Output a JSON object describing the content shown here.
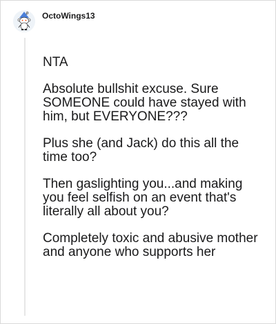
{
  "comment": {
    "username": "OctoWings13",
    "avatar_icon": "snoo-avatar-icon",
    "paragraphs": [
      "NTA",
      "Absolute bullshit excuse. Sure SOMEONE could have stayed with him, but EVERYONE???",
      "Plus she (and Jack) do this all the time too?",
      "Then gaslighting you...and making you feel selfish on an event that's literally all about you?",
      "Completely toxic and abusive mother and anyone who supports her"
    ]
  },
  "colors": {
    "text": "#1a1a1b",
    "avatar_blue": "#4a7fd8",
    "thread_line": "#e6e6e6"
  }
}
